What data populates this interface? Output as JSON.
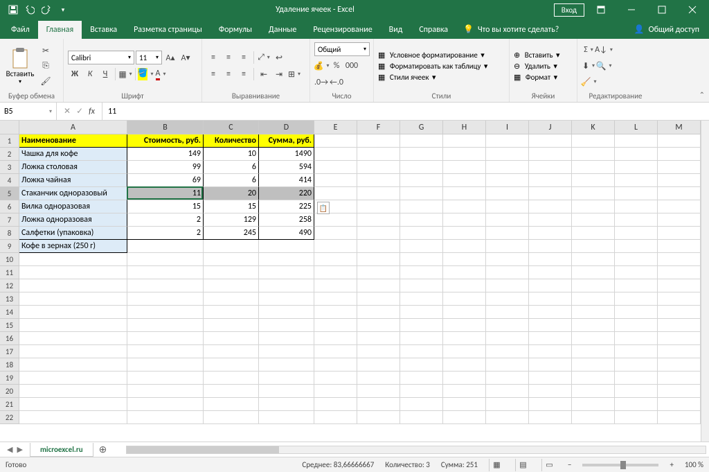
{
  "title": "Удаление ячеек  -  Excel",
  "login": "Вход",
  "tabs": {
    "file": "Файл",
    "home": "Главная",
    "insert": "Вставка",
    "layout": "Разметка страницы",
    "formulas": "Формулы",
    "data": "Данные",
    "review": "Рецензирование",
    "view": "Вид",
    "help": "Справка",
    "tellme": "Что вы хотите сделать?",
    "share": "Общий доступ"
  },
  "ribbon": {
    "clipboard": "Буфер обмена",
    "paste": "Вставить",
    "font": "Шрифт",
    "font_name": "Calibri",
    "font_size": "11",
    "align": "Выравнивание",
    "number": "Число",
    "numfmt": "Общий",
    "styles": "Стили",
    "cond": "Условное форматирование",
    "tbl": "Форматировать как таблицу",
    "cellst": "Стили ячеек",
    "cells": "Ячейки",
    "ins": "Вставить",
    "del": "Удалить",
    "fmt": "Формат",
    "edit": "Редактирование"
  },
  "fbar": {
    "name": "B5",
    "value": "11"
  },
  "cols": [
    "A",
    "B",
    "C",
    "D",
    "E",
    "F",
    "G",
    "H",
    "I",
    "J",
    "K",
    "L",
    "M"
  ],
  "widths": [
    156,
    110,
    80,
    80,
    62,
    62,
    62,
    62,
    62,
    62,
    62,
    62,
    62
  ],
  "headers": [
    "Наименование",
    "Стоимость, руб.",
    "Количество",
    "Сумма, руб."
  ],
  "rows": [
    {
      "a": "Чашка для кофе",
      "b": 149,
      "c": 10,
      "d": 1490
    },
    {
      "a": "Ложка столовая",
      "b": 99,
      "c": 6,
      "d": 594
    },
    {
      "a": "Ложка чайная",
      "b": 69,
      "c": 6,
      "d": 414
    },
    {
      "a": "Стаканчик одноразовый",
      "b": 11,
      "c": 20,
      "d": 220
    },
    {
      "a": "Вилка одноразовая",
      "b": 15,
      "c": 15,
      "d": 225
    },
    {
      "a": "Ложка одноразовая",
      "b": 2,
      "c": 129,
      "d": 258
    },
    {
      "a": "Салфетки (упаковка)",
      "b": 2,
      "c": 245,
      "d": 490
    },
    {
      "a": "Кофе в зернах (250 г)"
    }
  ],
  "sheet": "microexcel.ru",
  "status": {
    "ready": "Готово",
    "avg": "Среднее: 83,66666667",
    "cnt": "Количество: 3",
    "sum": "Сумма: 251",
    "zoom": "100 %"
  }
}
